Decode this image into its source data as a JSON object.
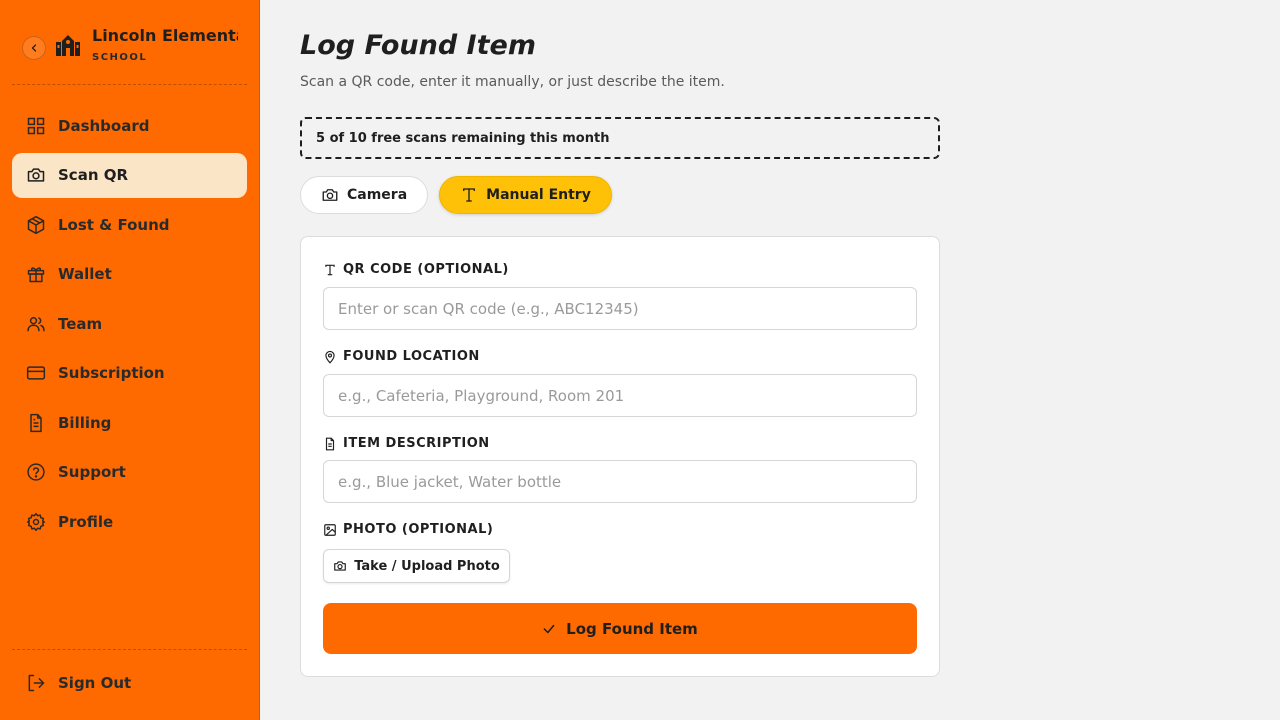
{
  "sidebar": {
    "brand_name": "Lincoln Elementary",
    "brand_sub": "SCHOOL",
    "items": [
      {
        "label": "Dashboard",
        "icon": "grid-icon"
      },
      {
        "label": "Scan QR",
        "icon": "camera-icon",
        "active": true
      },
      {
        "label": "Lost & Found",
        "icon": "package-icon"
      },
      {
        "label": "Wallet",
        "icon": "gift-icon"
      },
      {
        "label": "Team",
        "icon": "users-icon"
      },
      {
        "label": "Subscription",
        "icon": "credit-card-icon"
      },
      {
        "label": "Billing",
        "icon": "file-text-icon"
      },
      {
        "label": "Support",
        "icon": "help-circle-icon"
      },
      {
        "label": "Profile",
        "icon": "gear-icon"
      }
    ],
    "signout_label": "Sign Out"
  },
  "main": {
    "title": "Log Found Item",
    "subtitle": "Scan a QR code, enter it manually, or just describe the item.",
    "scan_banner": "5 of 10 free scans remaining this month",
    "tabs": [
      {
        "label": "Camera",
        "active": false
      },
      {
        "label": "Manual Entry",
        "active": true
      }
    ],
    "form": {
      "qr_label": "QR CODE (OPTIONAL)",
      "qr_placeholder": "Enter or scan QR code (e.g., ABC12345)",
      "location_label": "FOUND LOCATION",
      "location_placeholder": "e.g., Cafeteria, Playground, Room 201",
      "description_label": "ITEM DESCRIPTION",
      "description_placeholder": "e.g., Blue jacket, Water bottle",
      "photo_label": "PHOTO (OPTIONAL)",
      "photo_button": "Take / Upload Photo",
      "submit_label": "Log Found Item"
    }
  },
  "colors": {
    "sidebar_bg": "#ff6a00",
    "active_item_bg": "#fbe5c7",
    "manual_tab_bg": "#ffc107",
    "submit_bg": "#ff6a00",
    "page_bg": "#f2f2f2"
  }
}
